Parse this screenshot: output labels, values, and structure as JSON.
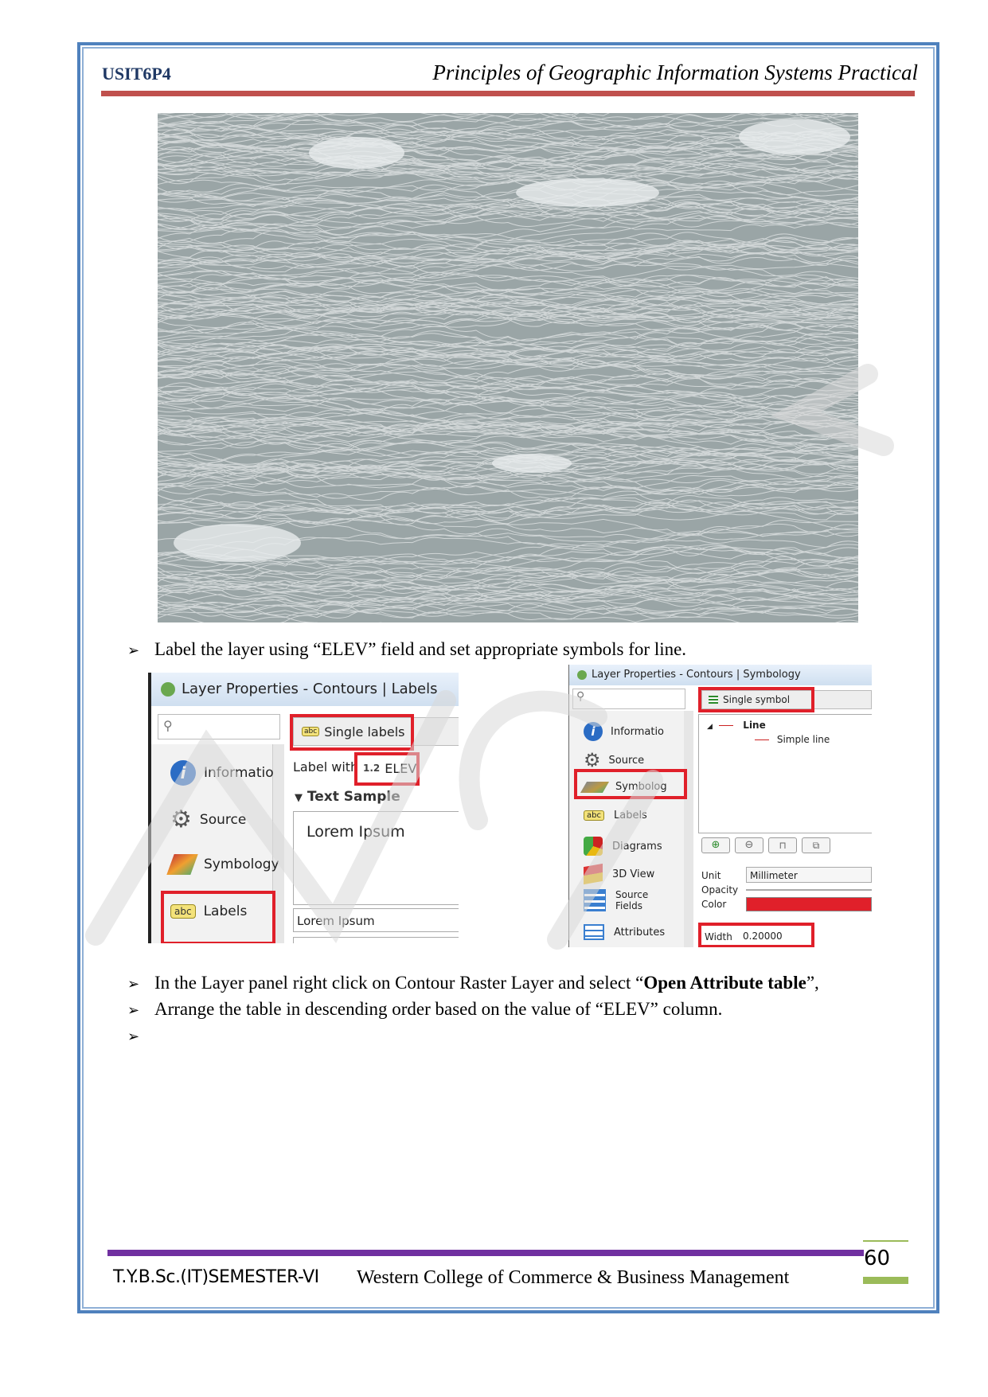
{
  "header": {
    "course_code": "USIT6P4",
    "title": "Principles of Geographic Information Systems Practical"
  },
  "bullets": [
    {
      "text": "Label the layer using “ELEV” field and set appropriate symbols for line."
    },
    {
      "text_before": "In the Layer panel right click on Contour Raster Layer and select “",
      "text_bold": "Open Attribute table",
      "text_after": "”,"
    },
    {
      "text": "Arrange the table in descending order based on the value of “ELEV” column."
    },
    {
      "text": ""
    }
  ],
  "labels_dialog": {
    "title": "Layer Properties - Contours | Labels",
    "mode": "Single labels",
    "label_with": "Label with",
    "field_type": "1.2",
    "field": "ELEV",
    "section": "Text Sample",
    "sample_text": "Lorem Ipsum",
    "sample_input": "Lorem Ipsum",
    "sidebar": [
      "Informatio",
      "Source",
      "Symbology",
      "Labels"
    ],
    "labels_badge": "abc"
  },
  "symbology_dialog": {
    "title": "Layer Properties - Contours | Symbology",
    "renderer": "Single symbol",
    "tree_root": "Line",
    "tree_child": "Simple line",
    "sidebar": [
      "Informatio",
      "Source",
      "Symbolog",
      "Labels",
      "Diagrams",
      "3D View",
      "Source Fields",
      "Attributes"
    ],
    "unit_label": "Unit",
    "unit_value": "Millimeter",
    "opacity_label": "Opacity",
    "color_label": "Color",
    "color": "#e0202a",
    "width_label": "Width",
    "width_value": "0.20000"
  },
  "footer": {
    "left": "T.Y.B.Sc.(IT)SEMESTER-VI",
    "college": "Western College of Commerce & Business Management",
    "page_number": "60"
  }
}
